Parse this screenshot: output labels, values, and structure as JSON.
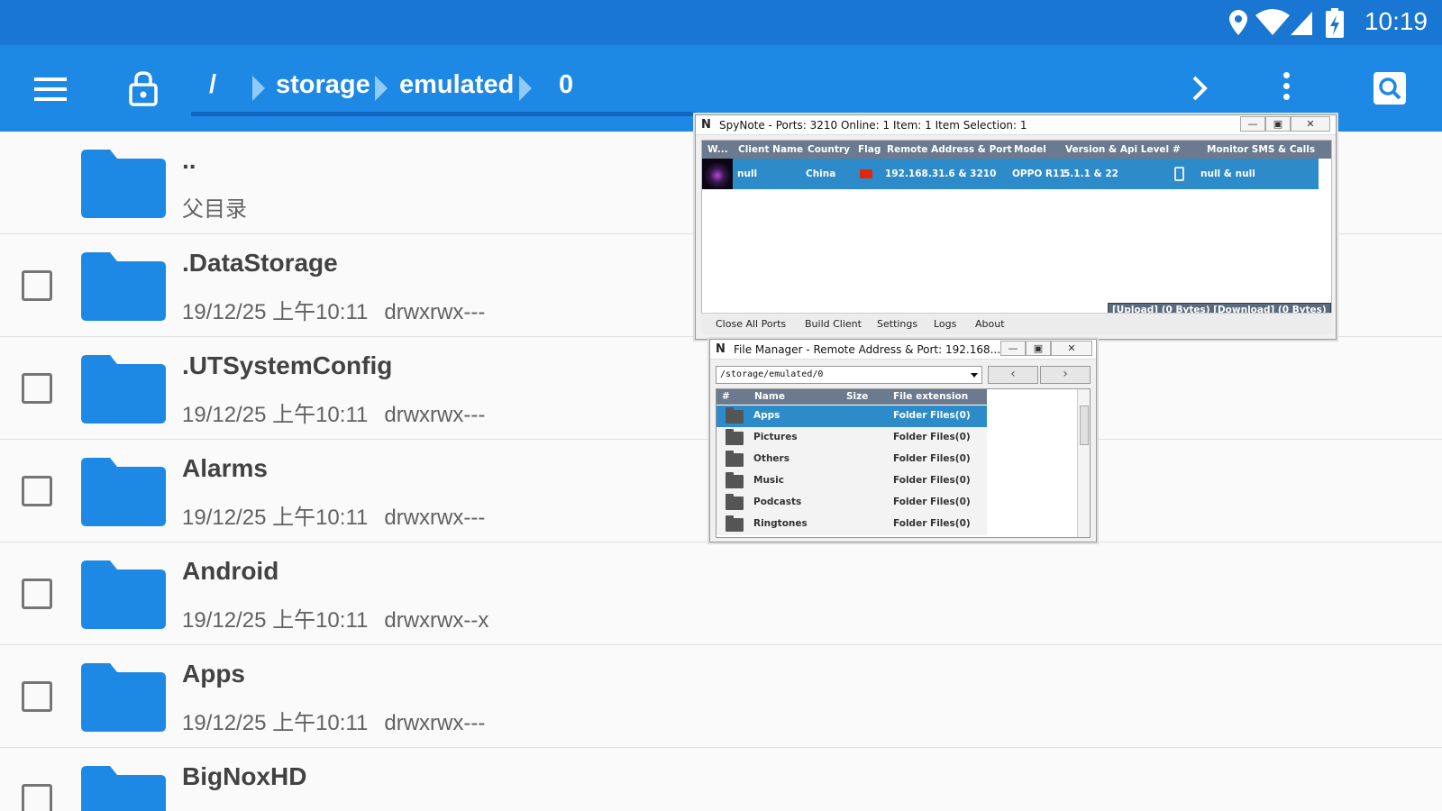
{
  "status_bar": {
    "time": "10:19"
  },
  "app_bar": {
    "breadcrumbs": [
      "/",
      "storage",
      "emulated",
      "0"
    ]
  },
  "files": [
    {
      "name": "..",
      "meta": "父目录",
      "perm": ""
    },
    {
      "name": ".DataStorage",
      "meta": "19/12/25 上午10:11",
      "perm": "drwxrwx---"
    },
    {
      "name": ".UTSystemConfig",
      "meta": "19/12/25 上午10:11",
      "perm": "drwxrwx---"
    },
    {
      "name": "Alarms",
      "meta": "19/12/25 上午10:11",
      "perm": "drwxrwx---"
    },
    {
      "name": "Android",
      "meta": "19/12/25 上午10:11",
      "perm": "drwxrwx--x"
    },
    {
      "name": "Apps",
      "meta": "19/12/25 上午10:11",
      "perm": "drwxrwx---"
    },
    {
      "name": "BigNoxHD",
      "meta": "",
      "perm": ""
    }
  ],
  "spynote": {
    "logo": "N",
    "title": "SpyNote - Ports: 3210 Online: 1 Item: 1 Item Selection: 1",
    "columns": [
      "W...",
      "Client Name",
      "Country",
      "Flag",
      "Remote Address & Port",
      "Model",
      "Version & Api Level",
      "#",
      "Monitor SMS & Calls"
    ],
    "client": {
      "name": "null",
      "country": "China",
      "address": "192.168.31.6 & 3210",
      "model": "OPPO R11",
      "version": "5.1.1 & 22",
      "monitor": "null & null"
    },
    "transfer": "[Upload] (0 Bytes) [Download] (0 Bytes)",
    "footer": [
      "Close All Ports",
      "Build Client",
      "Settings",
      "Logs",
      "About"
    ]
  },
  "file_manager": {
    "logo": "N",
    "title": "File Manager - Remote Address & Port: 192.168....",
    "path": "/storage/emulated/0",
    "columns": [
      "#",
      "Name",
      "Size",
      "File extension"
    ],
    "items": [
      {
        "name": "Apps",
        "ext": "Folder Files(0)"
      },
      {
        "name": "Pictures",
        "ext": "Folder Files(0)"
      },
      {
        "name": "Others",
        "ext": "Folder Files(0)"
      },
      {
        "name": "Music",
        "ext": "Folder Files(0)"
      },
      {
        "name": "Podcasts",
        "ext": "Folder Files(0)"
      },
      {
        "name": "Ringtones",
        "ext": "Folder Files(0)"
      }
    ]
  },
  "colors": {
    "status_bar": "#1976d2",
    "app_bar": "#1e88e5",
    "folder": "#1e88e5",
    "selection": "#2e8bc9"
  }
}
